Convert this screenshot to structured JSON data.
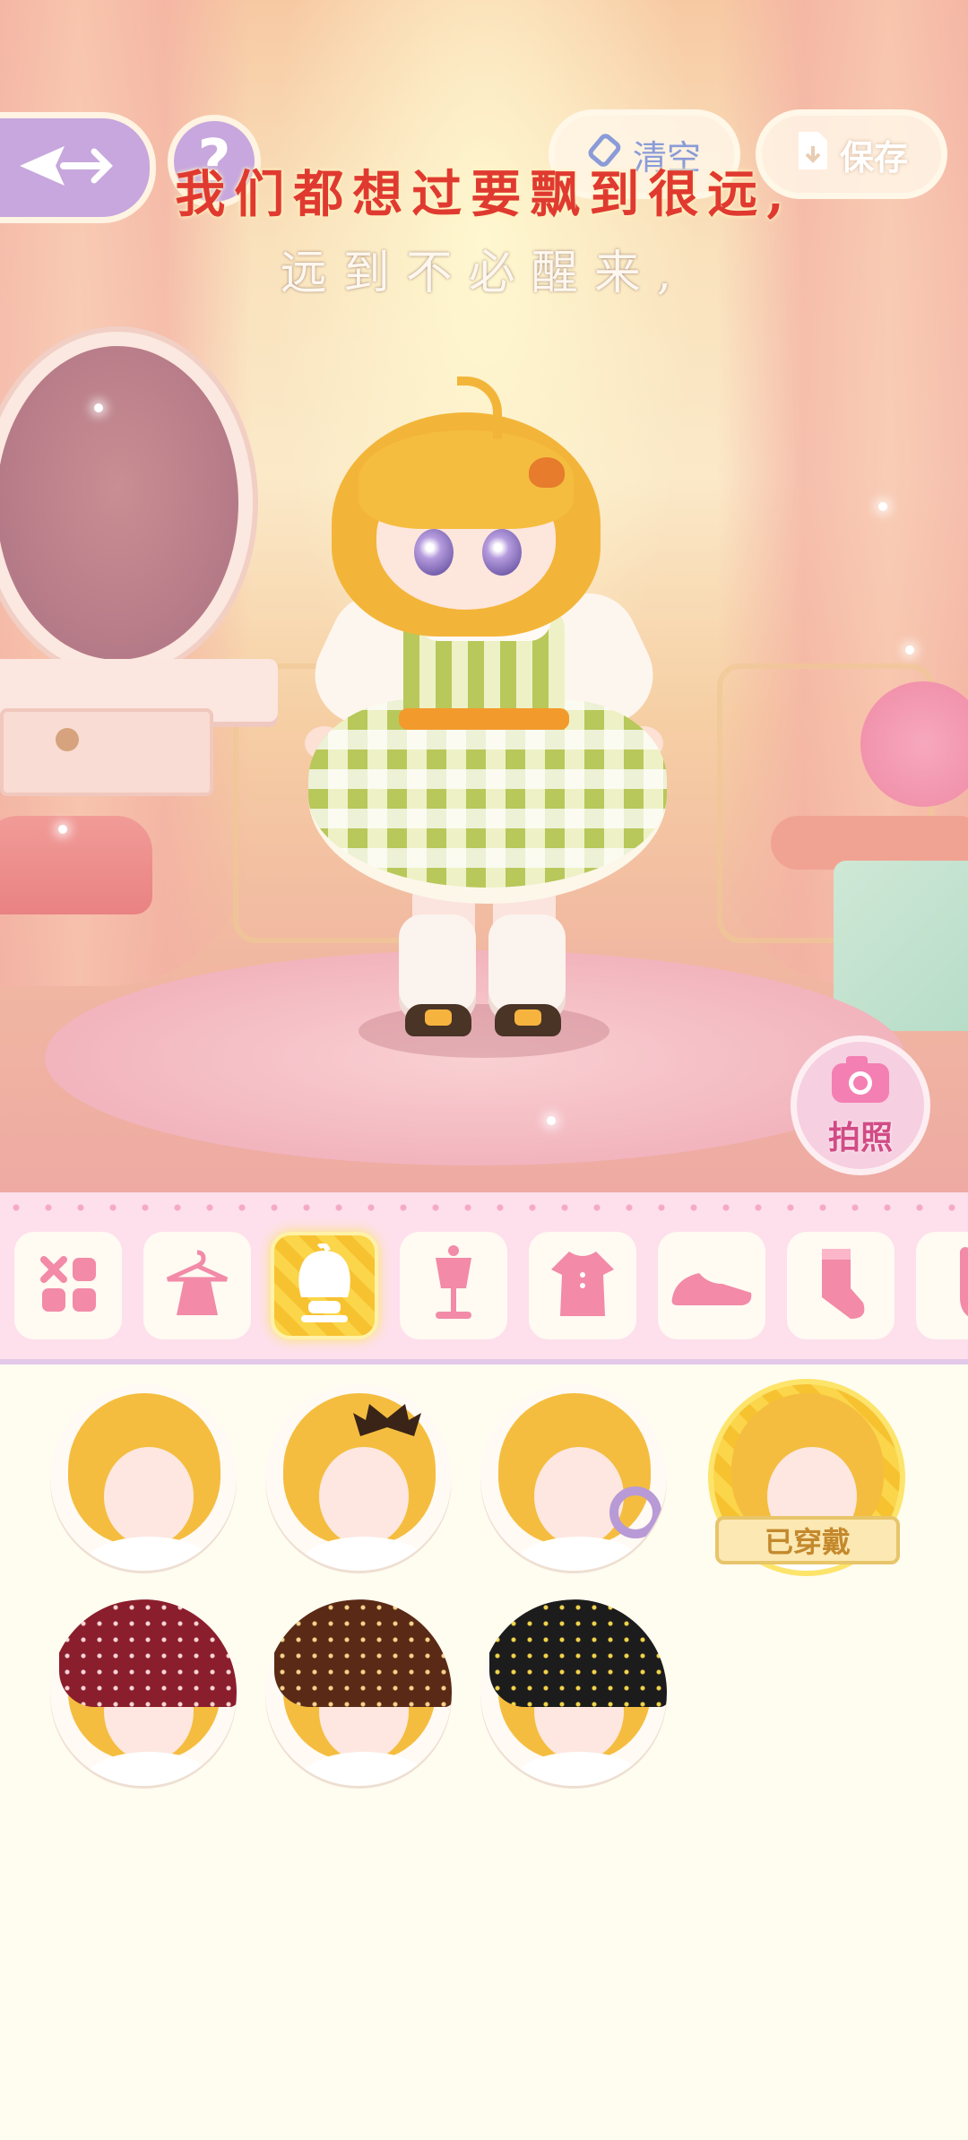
{
  "header": {
    "back_icon": "back-arrow-icon",
    "help_label": "?",
    "clear_label": "清空",
    "clear_icon": "eraser-icon",
    "save_label": "保存",
    "save_icon": "save-file-icon"
  },
  "lyrics": {
    "line1": "我们都想过要飘到很远,",
    "line2": "远到不必醒来,"
  },
  "photo": {
    "label": "拍照",
    "icon": "camera-icon"
  },
  "categories": [
    {
      "name": "all",
      "icon": "grid-icon",
      "active": false
    },
    {
      "name": "outfit-set",
      "icon": "dress-hanger-icon",
      "active": false
    },
    {
      "name": "hair",
      "icon": "hair-icon",
      "active": true
    },
    {
      "name": "top",
      "icon": "mannequin-icon",
      "active": false
    },
    {
      "name": "dress",
      "icon": "dress-icon",
      "active": false
    },
    {
      "name": "shoes",
      "icon": "shoe-icon",
      "active": false
    },
    {
      "name": "socks",
      "icon": "sock-icon",
      "active": false
    },
    {
      "name": "accessory",
      "icon": "accessory-icon",
      "active": false
    }
  ],
  "items": [
    {
      "name": "hair-item-1",
      "style": "long-wavy"
    },
    {
      "name": "hair-item-2",
      "style": "bat-clip"
    },
    {
      "name": "hair-item-3",
      "style": "braid-clip"
    },
    {
      "name": "hair-item-4",
      "style": "short-bob",
      "worn": true
    },
    {
      "name": "hair-item-5",
      "style": "red-polka-scarf",
      "color": "#8b1e2c"
    },
    {
      "name": "hair-item-6",
      "style": "brown-polka-scarf",
      "color": "#5a2a16"
    },
    {
      "name": "hair-item-7",
      "style": "black-polka-scarf",
      "color": "#1c1c1c"
    }
  ],
  "worn_badge": "已穿戴",
  "colors": {
    "accent_purple": "#c7a7dd",
    "tab_active_yellow": "#fbd54a",
    "category_bar_pink": "#fde0ec",
    "icon_pink": "#f28aa8"
  }
}
